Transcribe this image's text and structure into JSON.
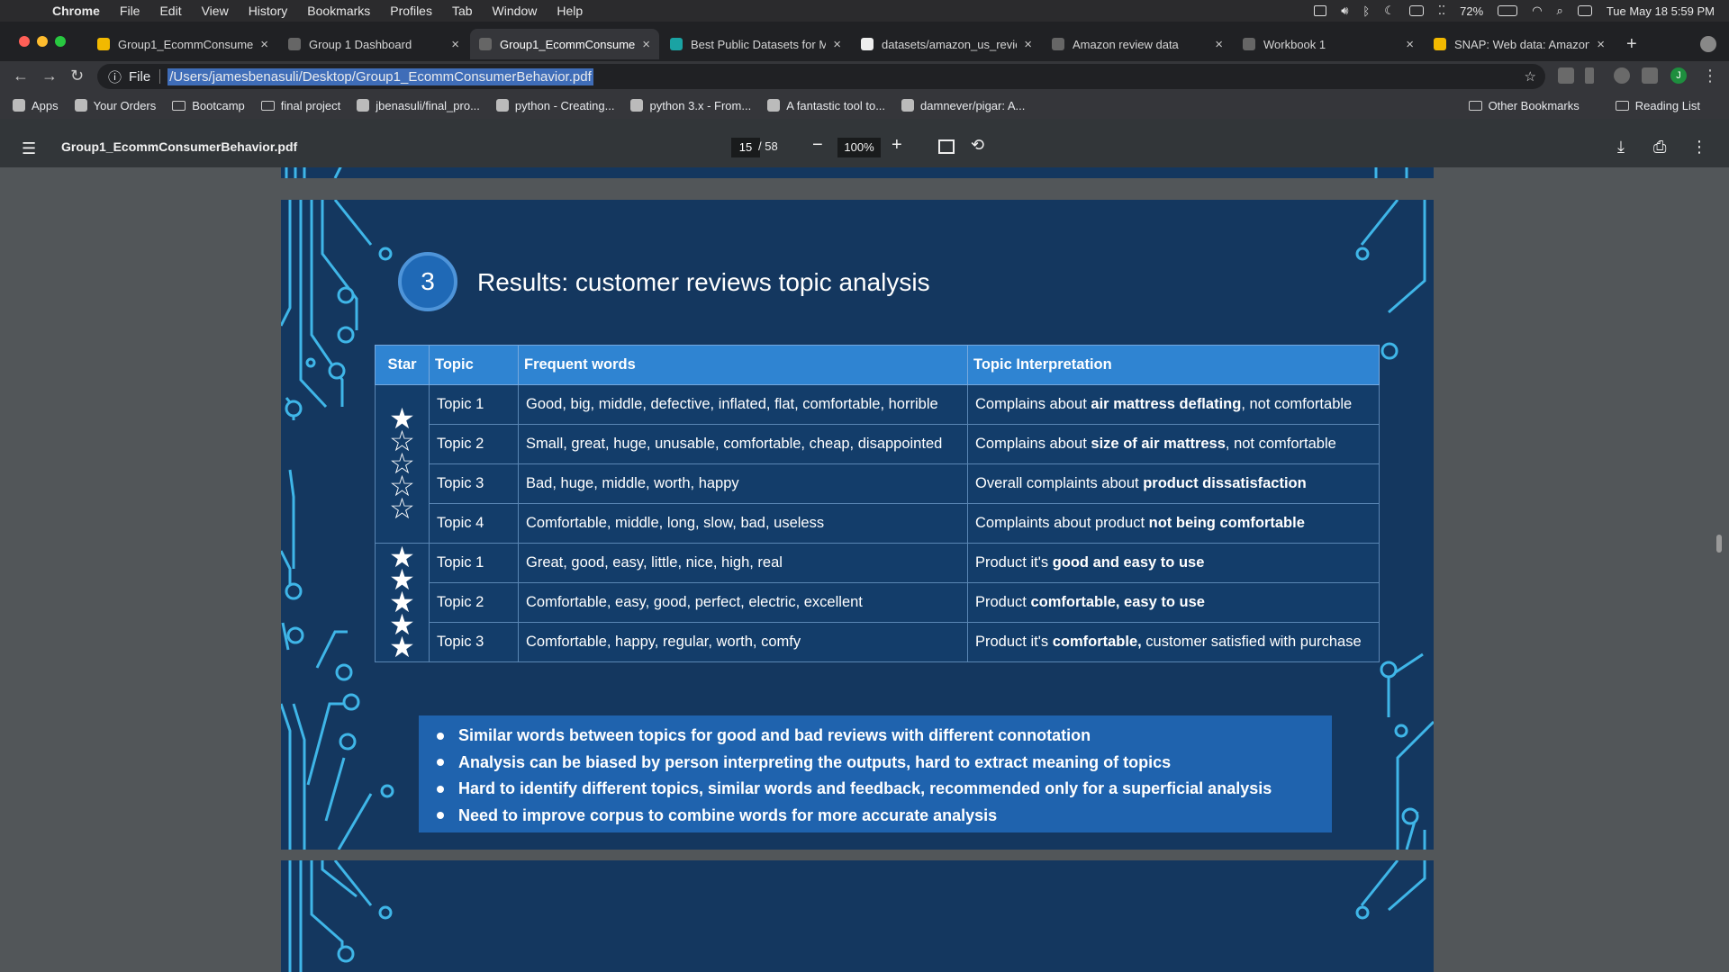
{
  "menubar": {
    "app": "Chrome",
    "items": [
      "File",
      "Edit",
      "View",
      "History",
      "Bookmarks",
      "Profiles",
      "Tab",
      "Window",
      "Help"
    ],
    "battery": "72%",
    "clock": "Tue May 18  5:59 PM"
  },
  "tabs": [
    {
      "title": "Group1_EcommConsumer",
      "active": false,
      "favicon_color": "#f2b900"
    },
    {
      "title": "Group 1 Dashboard",
      "active": false,
      "favicon_color": "#666"
    },
    {
      "title": "Group1_EcommConsumer",
      "active": true,
      "favicon_color": "#666"
    },
    {
      "title": "Best Public Datasets for M",
      "active": false,
      "favicon_color": "#1aa3a3"
    },
    {
      "title": "datasets/amazon_us_revie",
      "active": false,
      "favicon_color": "#eee"
    },
    {
      "title": "Amazon review data",
      "active": false,
      "favicon_color": "#666"
    },
    {
      "title": "Workbook 1",
      "active": false,
      "favicon_color": "#666"
    },
    {
      "title": "SNAP: Web data: Amazon",
      "active": false,
      "favicon_color": "#f2b900"
    }
  ],
  "omnibox": {
    "scheme": "File",
    "url": "/Users/jamesbenasuli/Desktop/Group1_EcommConsumerBehavior.pdf"
  },
  "profile_initial": "J",
  "bookmarks": {
    "items": [
      {
        "label": "Apps",
        "icon": "apps-grid-icon"
      },
      {
        "label": "Your Orders",
        "icon": "amazon-icon"
      },
      {
        "label": "Bootcamp",
        "icon": "folder-icon"
      },
      {
        "label": "final project",
        "icon": "folder-icon"
      },
      {
        "label": "jbenasuli/final_pro...",
        "icon": "github-icon"
      },
      {
        "label": "python - Creating...",
        "icon": "stackoverflow-icon"
      },
      {
        "label": "python 3.x - From...",
        "icon": "stackoverflow-icon"
      },
      {
        "label": "A fantastic tool to...",
        "icon": "python-icon"
      },
      {
        "label": "damnever/pigar: A...",
        "icon": "github-icon"
      }
    ],
    "other": "Other Bookmarks",
    "reading_list": "Reading List"
  },
  "pdf": {
    "filename": "Group1_EcommConsumerBehavior.pdf",
    "page_current": "15",
    "page_total": "/ 58",
    "zoom": "100%"
  },
  "slide": {
    "number": "3",
    "title": "Results: customer reviews topic analysis",
    "headers": [
      "Star",
      "Topic",
      "Frequent words",
      "Topic Interpretation"
    ],
    "groups": [
      {
        "stars_filled": 1,
        "stars_total": 5,
        "rows": [
          {
            "topic": "Topic 1",
            "words": "Good, big, middle, defective, inflated, flat, comfortable, horrible",
            "pre": "Complains about ",
            "bold": "air mattress deflating",
            "post": ", not comfortable"
          },
          {
            "topic": "Topic 2",
            "words": "Small, great, huge, unusable, comfortable, cheap, disappointed",
            "pre": "Complains about ",
            "bold": "size of air mattress",
            "post": ",  not comfortable"
          },
          {
            "topic": "Topic 3",
            "words": "Bad, huge, middle, worth, happy",
            "pre": "Overall complaints about ",
            "bold": "product dissatisfaction",
            "post": ""
          },
          {
            "topic": "Topic 4",
            "words": "Comfortable, middle, long, slow, bad, useless",
            "pre": "Complaints about product ",
            "bold": "not being comfortable",
            "post": ""
          }
        ]
      },
      {
        "stars_filled": 5,
        "stars_total": 5,
        "rows": [
          {
            "topic": "Topic 1",
            "words": "Great, good, easy, little, nice, high, real",
            "pre": "Product it's ",
            "bold": "good and easy to use",
            "post": ""
          },
          {
            "topic": "Topic 2",
            "words": "Comfortable, easy, good, perfect, electric, excellent",
            "pre": "Product ",
            "bold": "comfortable, easy to use",
            "post": ""
          },
          {
            "topic": "Topic 3",
            "words": "Comfortable, happy, regular, worth, comfy",
            "pre": "Product it's ",
            "bold": "comfortable,",
            "post": " customer satisfied with purchase"
          }
        ]
      }
    ],
    "bullets": [
      "Similar words between topics for good and bad reviews with different connotation",
      "Analysis can be biased by person interpreting the outputs, hard to extract meaning of topics",
      "Hard to identify different topics, similar words and feedback, recommended only for a superficial analysis",
      "Need to improve corpus to combine words for more accurate analysis"
    ]
  }
}
